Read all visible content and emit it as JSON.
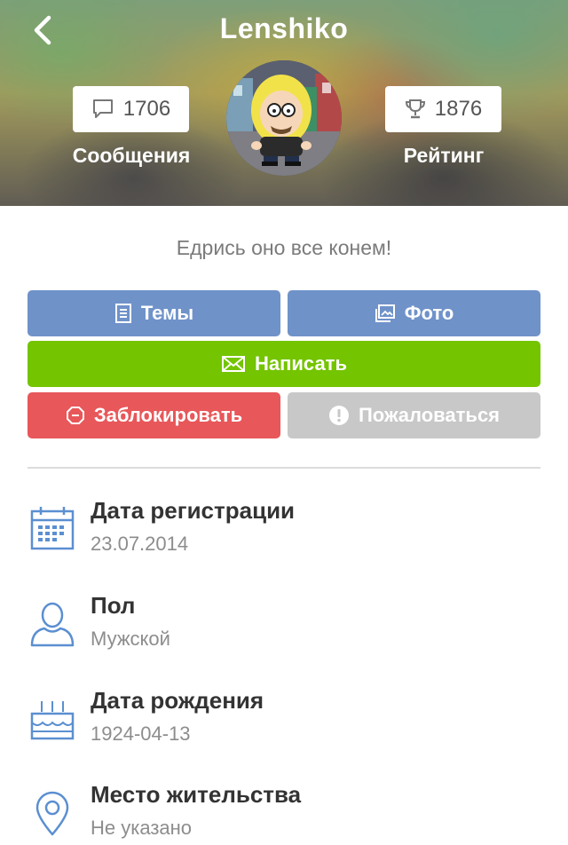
{
  "header": {
    "title": "Lenshiko",
    "back_icon": "chevron-left-icon",
    "messages": {
      "count": "1706",
      "label": "Сообщения",
      "icon": "comment-icon"
    },
    "rating": {
      "count": "1876",
      "label": "Рейтинг",
      "icon": "trophy-icon"
    }
  },
  "profile": {
    "status": "Едрись оно все конем!"
  },
  "actions": {
    "topics": {
      "label": "Темы",
      "icon": "document-icon"
    },
    "photo": {
      "label": "Фото",
      "icon": "image-icon"
    },
    "write": {
      "label": "Написать",
      "icon": "envelope-icon"
    },
    "block": {
      "label": "Заблокировать",
      "icon": "block-octagon-icon"
    },
    "report": {
      "label": "Пожаловаться",
      "icon": "alert-circle-icon"
    }
  },
  "info": [
    {
      "title": "Дата регистрации",
      "value": "23.07.2014",
      "icon": "calendar-icon"
    },
    {
      "title": "Пол",
      "value": "Мужской",
      "icon": "user-icon"
    },
    {
      "title": "Дата рождения",
      "value": "1924-04-13",
      "icon": "birthday-cake-icon"
    },
    {
      "title": "Место жительства",
      "value": "Не указано",
      "icon": "location-pin-icon"
    }
  ],
  "colors": {
    "accent_blue": "#6f92c9",
    "write_green": "#74c400",
    "block_red": "#e8575a",
    "report_gray": "#c8c8c8",
    "icon_blue": "#5b8fd1"
  }
}
